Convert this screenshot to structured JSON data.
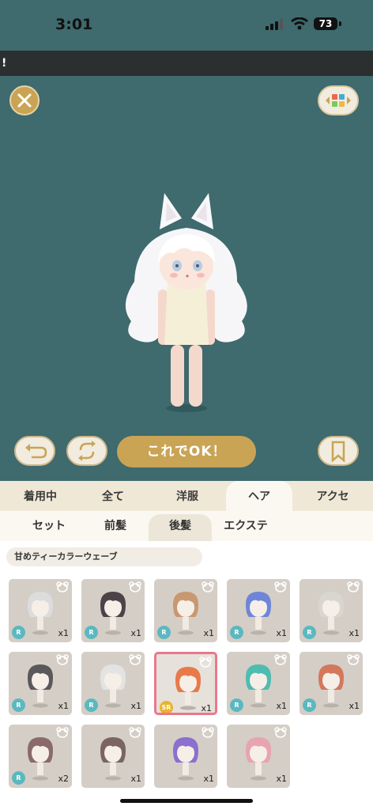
{
  "status_bar": {
    "time": "3:01",
    "battery": "73"
  },
  "ticker": {
    "text": "!"
  },
  "actions": {
    "ok_label": "これでOK！"
  },
  "tabs": [
    {
      "label": "着用中"
    },
    {
      "label": "全て"
    },
    {
      "label": "洋服"
    },
    {
      "label": "ヘア",
      "active": true
    },
    {
      "label": "アクセ"
    }
  ],
  "subtabs": [
    {
      "label": "セット"
    },
    {
      "label": "前髪"
    },
    {
      "label": "後髪",
      "active": true
    },
    {
      "label": "エクステ"
    }
  ],
  "selected_item_name": "甘めティーカラーウェーブ",
  "items": [
    {
      "rank": "R",
      "count": "x1",
      "hair_color": "#dcdcdc"
    },
    {
      "rank": "R",
      "count": "x1",
      "hair_color": "#4a4448"
    },
    {
      "rank": "R",
      "count": "x1",
      "hair_color": "#c89870"
    },
    {
      "rank": "R",
      "count": "x1",
      "hair_color": "#6f86d8"
    },
    {
      "rank": "R",
      "count": "x1",
      "hair_color": "#d9d6cf"
    },
    {
      "rank": "R",
      "count": "x1",
      "hair_color": "#5a585c"
    },
    {
      "rank": "R",
      "count": "x1",
      "hair_color": "#e3e3e3"
    },
    {
      "rank": "SR",
      "count": "x1",
      "hair_color": "#e87a4a"
    },
    {
      "rank": "R",
      "count": "x1",
      "hair_color": "#4fbcb0"
    },
    {
      "rank": "R",
      "count": "x1",
      "hair_color": "#d4785c"
    },
    {
      "rank": "R",
      "count": "x2",
      "hair_color": "#8a6a6a"
    },
    {
      "rank": "",
      "count": "x1",
      "hair_color": "#7a6560"
    },
    {
      "rank": "",
      "count": "x1",
      "hair_color": "#8c6fcf"
    },
    {
      "rank": "",
      "count": "x1",
      "hair_color": "#e8a4b0"
    }
  ]
}
